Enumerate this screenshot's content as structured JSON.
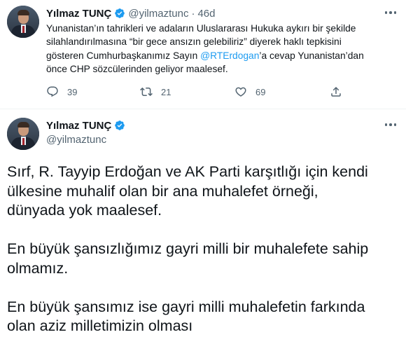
{
  "tweet1": {
    "author_name": "Yılmaz TUNÇ",
    "handle": "@yilmaztunc",
    "separator": "·",
    "time": "46d",
    "text_lines": [
      "Yunanistan’ın tahrikleri ve adaların Uluslararası Hukuka aykırı bir şekilde",
      "silahlandırılmasına “bir gece ansızın gelebiliriz” diyerek haklı tepkisini",
      "gösteren Cumhurbaşkanımız Sayın ",
      "@RTErdogan",
      "’a cevap Yunanistan’dan",
      "önce CHP sözcülerinden geliyor maalesef."
    ],
    "actions": {
      "reply_count": "39",
      "retweet_count": "21",
      "like_count": "69"
    }
  },
  "tweet2": {
    "author_name": "Yılmaz TUNÇ",
    "handle": "@yilmaztunc",
    "paragraphs": [
      [
        "Sırf, R. Tayyip Erdoğan ve AK Parti  karşıtlığı için kendi",
        "ülkesine muhalif olan bir ana muhalefet örneği,",
        "dünyada yok maalesef."
      ],
      [
        "En büyük şansızlığımız gayri milli bir muhalefete sahip",
        "olmamız."
      ],
      [
        "En büyük şansımız ise gayri milli muhalefetin farkında",
        "olan aziz milletimizin olması"
      ]
    ]
  },
  "colors": {
    "accent": "#1d9bf0",
    "text_primary": "#0f1419",
    "text_secondary": "#536471",
    "divider": "#eff3f4"
  },
  "icons": [
    "verified-badge-icon",
    "more-icon",
    "reply-icon",
    "retweet-icon",
    "like-icon",
    "share-icon"
  ]
}
